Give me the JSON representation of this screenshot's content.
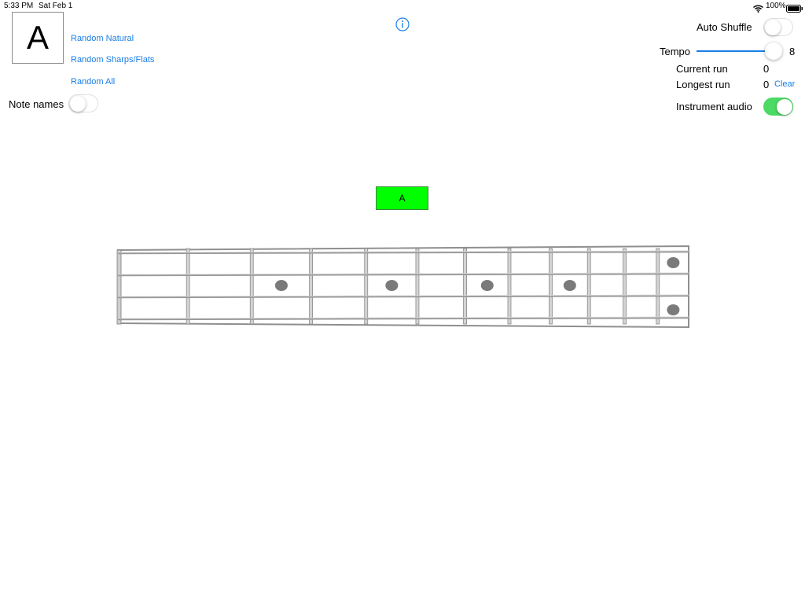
{
  "status_bar": {
    "time": "5:33 PM",
    "date": "Sat Feb 1",
    "battery": "100%"
  },
  "current_note": "A",
  "links": {
    "random_natural": "Random Natural",
    "random_sharps_flats": "Random Sharps/Flats",
    "random_all": "Random All"
  },
  "note_names": {
    "label": "Note names",
    "on": false
  },
  "info_icon": "info-icon",
  "auto_shuffle": {
    "label": "Auto Shuffle",
    "on": false
  },
  "tempo": {
    "label": "Tempo",
    "value": "8",
    "level": 1.0
  },
  "current_run": {
    "label": "Current run",
    "value": "0"
  },
  "longest_run": {
    "label": "Longest run",
    "value": "0",
    "clear": "Clear"
  },
  "instrument_audio": {
    "label": "Instrument audio",
    "on": true
  },
  "note_indicator": "A",
  "fretboard": {
    "strings": 4,
    "frets": 12,
    "single_dot_frets": [
      3,
      5,
      7,
      9
    ],
    "double_dot_frets": [
      12
    ]
  },
  "colors": {
    "accent": "#1a7ee6",
    "toggle_on": "#4cd964",
    "note_indicator": "#00ff00"
  }
}
